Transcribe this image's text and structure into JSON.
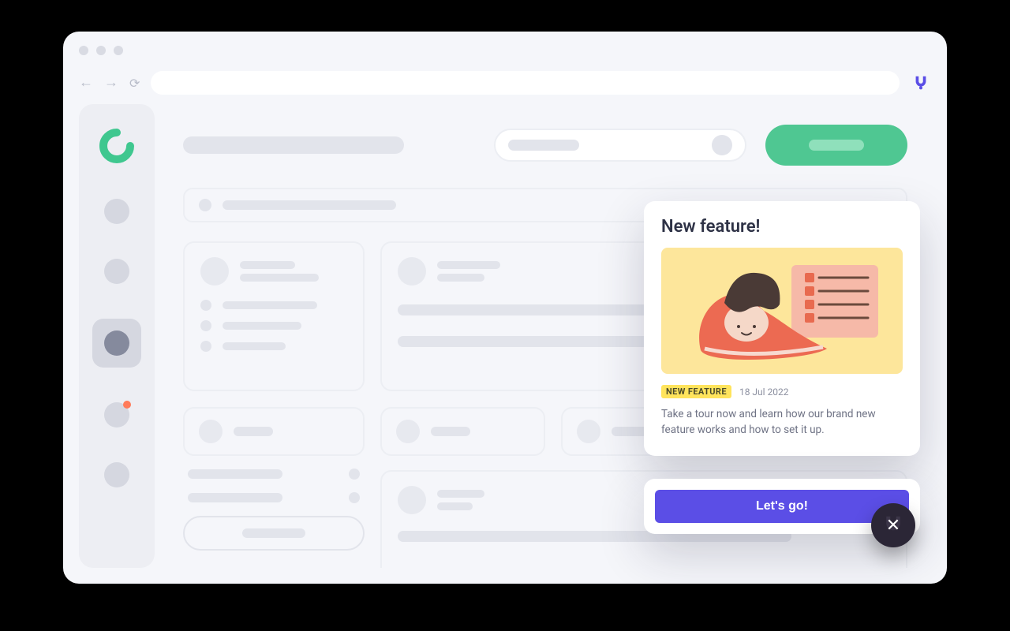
{
  "announcement": {
    "title": "New feature!",
    "tag": "NEW FEATURE",
    "date": "18 Jul 2022",
    "description": "Take a tour now and learn how our brand new feature works and how to set it up.",
    "cta_label": "Let's go!"
  },
  "colors": {
    "accent_green": "#4fc792",
    "accent_purple": "#5b4ee6",
    "tag_yellow": "#ffe45c",
    "illustration_bg": "#fde69b"
  }
}
